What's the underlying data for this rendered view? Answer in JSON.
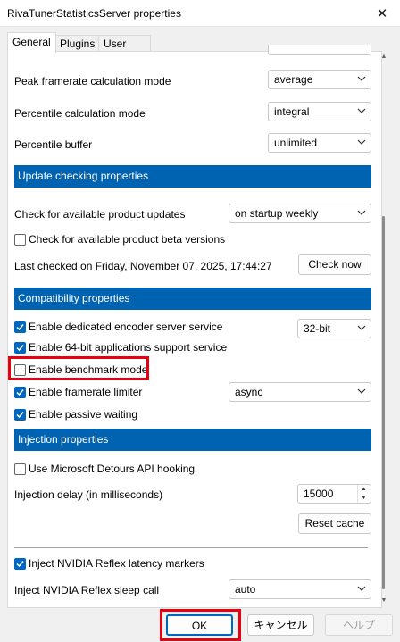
{
  "window": {
    "title": "RivaTunerStatisticsServer properties"
  },
  "tabs": [
    {
      "label": "General"
    },
    {
      "label": "Plugins"
    },
    {
      "label": "User Interface"
    }
  ],
  "settings": {
    "peak_framerate": {
      "label": "Peak framerate calculation mode",
      "value": "average"
    },
    "percentile_calc": {
      "label": "Percentile calculation mode",
      "value": "integral"
    },
    "percentile_buffer": {
      "label": "Percentile buffer",
      "value": "unlimited"
    }
  },
  "update": {
    "header": "Update checking properties",
    "check_label": "Check for available product updates",
    "check_value": "on startup weekly",
    "beta_label": "Check for available product beta versions",
    "last_checked": "Last checked on Friday, November 07, 2025, 17:44:27",
    "check_now": "Check now"
  },
  "compat": {
    "header": "Compatibility properties",
    "encoder_label": "Enable dedicated encoder server service",
    "encoder_value": "32-bit",
    "x64_label": "Enable 64-bit applications support service",
    "benchmark_label": "Enable benchmark mode",
    "limiter_label": "Enable framerate limiter",
    "limiter_value": "async",
    "passive_label": "Enable passive waiting"
  },
  "injection": {
    "header": "Injection properties",
    "detours_label": "Use Microsoft Detours API hooking",
    "delay_label": "Injection delay (in milliseconds)",
    "delay_value": "15000",
    "reset_cache": "Reset cache",
    "reflex_markers_label": "Inject NVIDIA Reflex latency markers",
    "reflex_sleep_label": "Inject NVIDIA Reflex sleep call",
    "reflex_sleep_value": "auto"
  },
  "buttons": {
    "ok": "OK",
    "cancel": "キャンセル",
    "help": "ヘルプ"
  },
  "colors": {
    "accent": "#0067c0",
    "header": "#0063b1",
    "highlight": "#e8000e"
  }
}
